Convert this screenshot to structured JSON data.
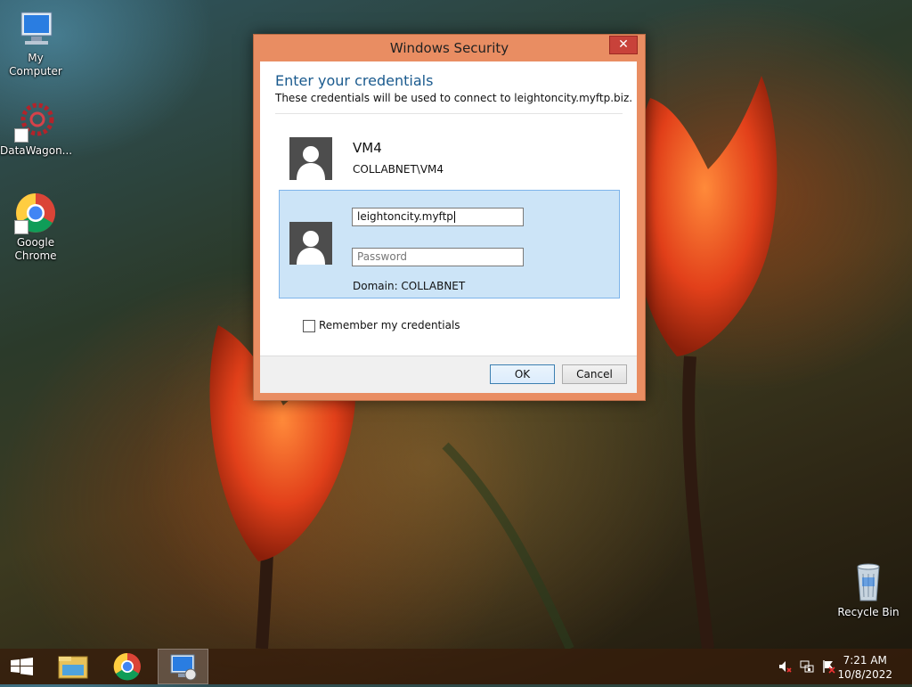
{
  "desktop": {
    "icons": [
      {
        "label": "My Computer"
      },
      {
        "label": "DataWagon..."
      },
      {
        "label_line1": "Google",
        "label_line2": "Chrome"
      },
      {
        "label": "Recycle Bin"
      }
    ]
  },
  "dialog": {
    "title": "Windows Security",
    "close_glyph": "✕",
    "heading": "Enter your credentials",
    "subtext": "These credentials will be used to connect to leightoncity.myftp.biz.",
    "saved_account": {
      "name": "VM4",
      "domain": "COLLABNET\\VM4"
    },
    "username_value": "leightoncity.myftp",
    "password_placeholder": "Password",
    "domain_label": "Domain: COLLABNET",
    "remember_label": "Remember my credentials",
    "remember_checked": false,
    "ok_label": "OK",
    "cancel_label": "Cancel"
  },
  "taskbar": {
    "items": [
      "windows-start-icon",
      "file-explorer-icon",
      "chrome-icon",
      "remote-desktop-icon"
    ],
    "active_item": "remote-desktop-icon",
    "tray_icons": [
      "speaker-muted-icon",
      "network-icon",
      "action-center-icon"
    ],
    "clock": {
      "time": "7:21 AM",
      "date": "10/8/2022"
    }
  },
  "colors": {
    "dialog_frame": "#e98d62",
    "close_button": "#c8423a",
    "heading": "#1a5a8e",
    "selected_tile": "#cce4f7",
    "selected_tile_border": "#7eb4ea"
  }
}
